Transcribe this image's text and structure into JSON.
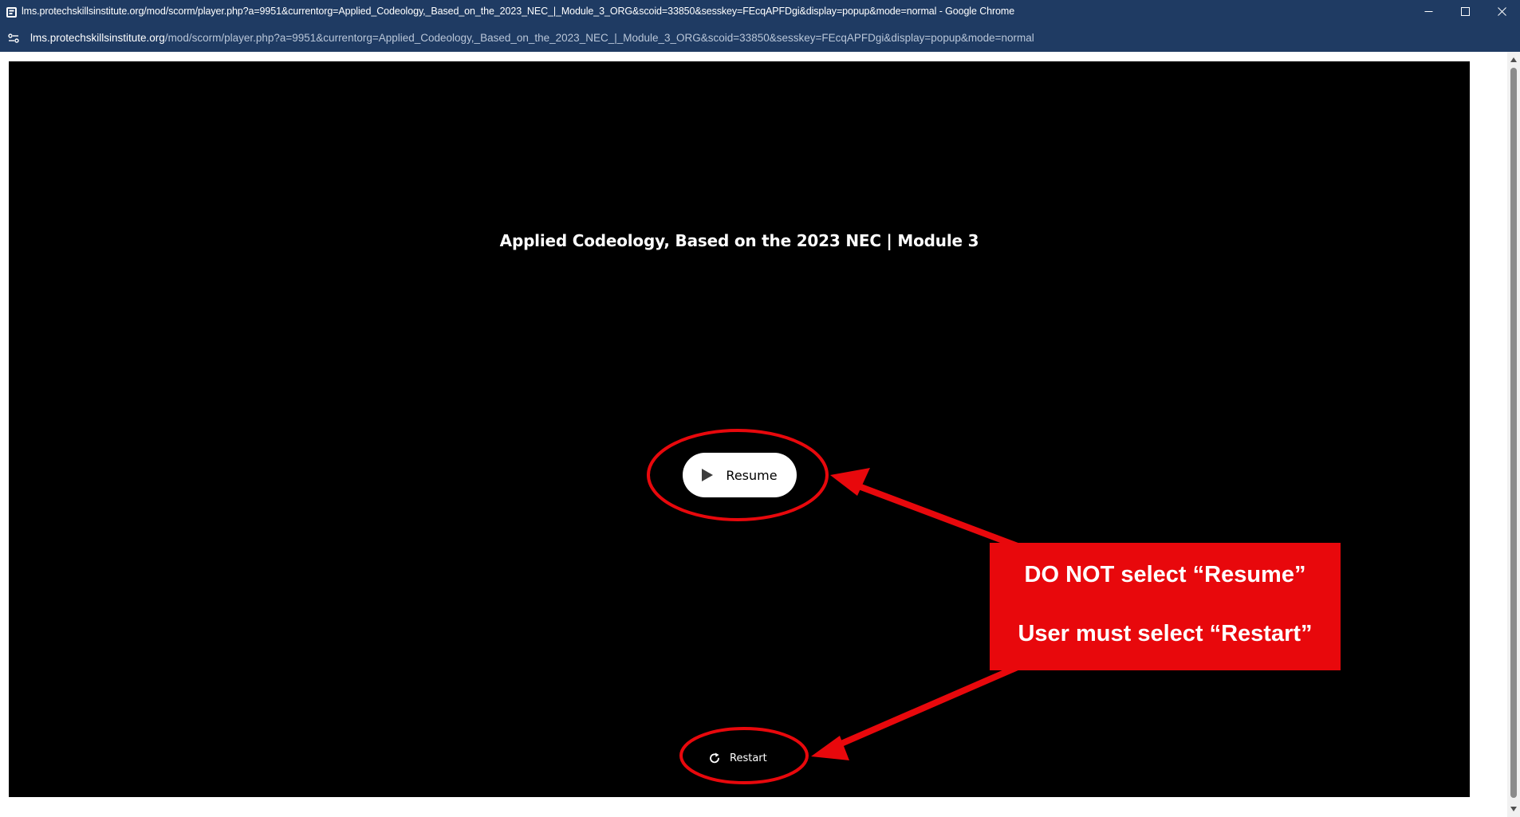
{
  "window": {
    "title": "lms.protechskillsinstitute.org/mod/scorm/player.php?a=9951&currentorg=Applied_Codeology,_Based_on_the_2023_NEC_|_Module_3_ORG&scoid=33850&sesskey=FEcqAPFDgi&display=popup&mode=normal - Google Chrome",
    "controls": {
      "minimize_icon": "minimize-icon",
      "maximize_icon": "maximize-icon",
      "close_icon": "close-icon"
    }
  },
  "address_bar": {
    "domain": "lms.protechskillsinstitute.org",
    "path": "/mod/scorm/player.php?a=9951&currentorg=Applied_Codeology,_Based_on_the_2023_NEC_|_Module_3_ORG&scoid=33850&sesskey=FEcqAPFDgi&display=popup&mode=normal"
  },
  "player": {
    "course_title": "Applied Codeology, Based on the 2023 NEC | Module 3",
    "resume_label": "Resume",
    "restart_label": "Restart"
  },
  "annotation": {
    "line1": "DO NOT select “Resume”",
    "line2": "User must select “Restart”",
    "color": "#e8080c"
  },
  "colors": {
    "chrome_frame": "#1f3b63",
    "player_background": "#000000"
  }
}
